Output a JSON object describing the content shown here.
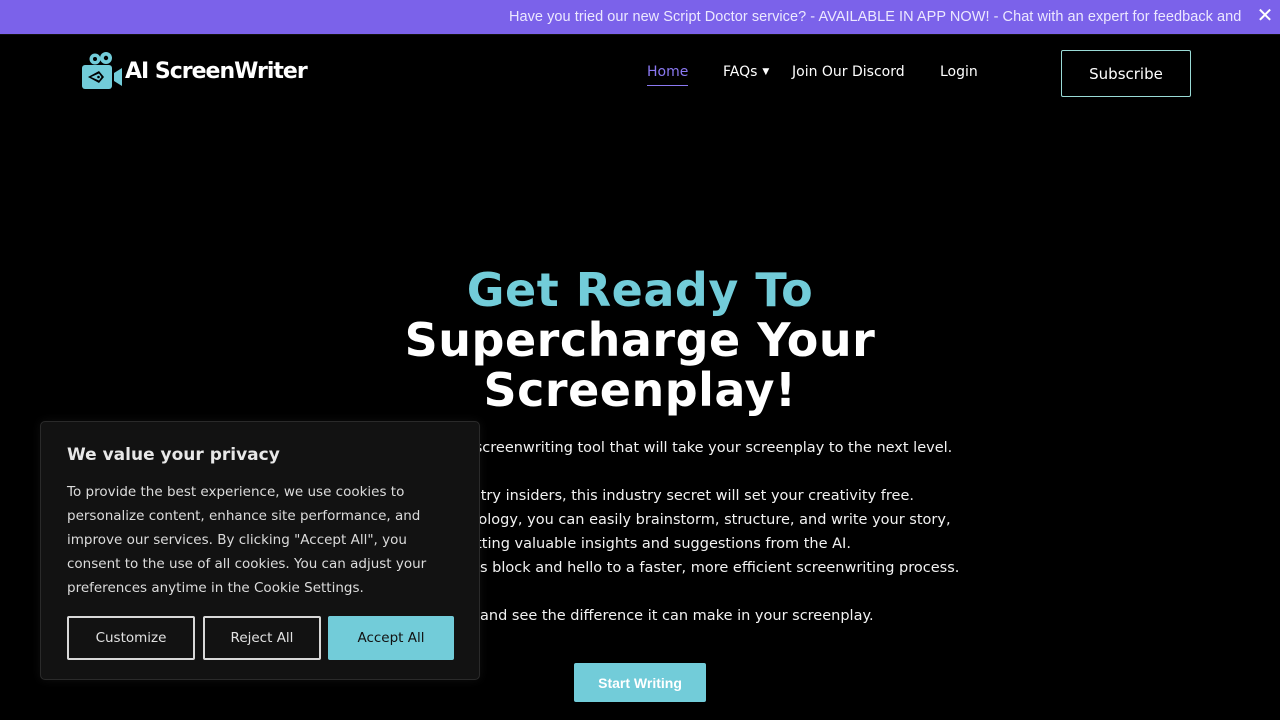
{
  "announcement": {
    "text": "Have you tried our new Script Doctor service? -  AVAILABLE IN APP NOW! - Chat with an expert for feedback and",
    "close_icon": "close-icon"
  },
  "header": {
    "logo_text": "AI ScreenWriter",
    "logo_icon": "film-camera-pen-icon",
    "nav": [
      {
        "label": "Home",
        "active": true
      },
      {
        "label": "FAQs",
        "has_dropdown": true
      },
      {
        "label": "Join Our Discord"
      },
      {
        "label": "Login"
      }
    ],
    "subscribe_label": "Subscribe"
  },
  "hero": {
    "title_accent": "Get Ready To",
    "title_line2": "Supercharge Your",
    "title_line3": "Screenplay!",
    "paragraph_lines": [
      "ed screenwriting tool that will take your screenplay to the next level.",
      "",
      "ustry insiders, this industry secret will set your creativity free.",
      "nnology, you can easily brainstorm, structure, and write your story,",
      "getting valuable insights and suggestions from the AI.",
      "'s block and hello to a faster, more efficient screenwriting process.",
      "",
      "and see the difference it can make in your screenplay."
    ],
    "cta_label": "Start Writing"
  },
  "cookie_banner": {
    "title": "We value your privacy",
    "body": "To provide the best experience, we use cookies to personalize content, enhance site performance, and improve our services. By clicking \"Accept All\", you consent to the use of all cookies. You can adjust your preferences anytime in the Cookie Settings.",
    "buttons": {
      "customize": "Customize",
      "reject": "Reject All",
      "accept": "Accept All"
    }
  },
  "colors": {
    "announcement_bg": "#7b62ea",
    "accent_teal": "#72ccd9",
    "nav_active": "#8b79f2",
    "page_bg": "#000000",
    "cookie_bg": "#121212"
  }
}
